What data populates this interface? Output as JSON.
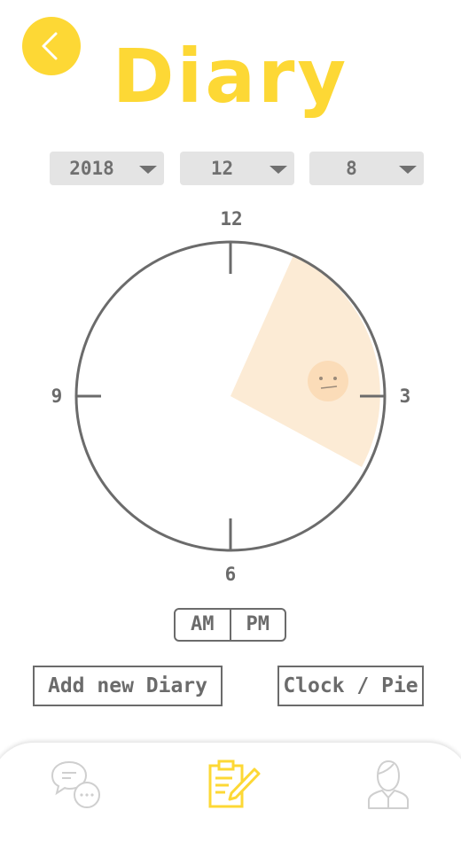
{
  "header": {
    "title": "Diary"
  },
  "date": {
    "year": "2018",
    "month": "12",
    "day": "8"
  },
  "clock": {
    "labels": {
      "top": "12",
      "right": "3",
      "bottom": "6",
      "left": "9"
    }
  },
  "period": {
    "am": "AM",
    "pm": "PM"
  },
  "actions": {
    "add": "Add new Diary",
    "toggle": "Clock / Pie"
  },
  "nav": [
    "chat-icon",
    "diary-edit-icon",
    "profile-icon"
  ],
  "colors": {
    "accent": "#fdd835",
    "slice": "#fcebd5",
    "emoji": "#fbdcb8",
    "text": "#6b6b6b",
    "select_bg": "#e4e4e4"
  }
}
